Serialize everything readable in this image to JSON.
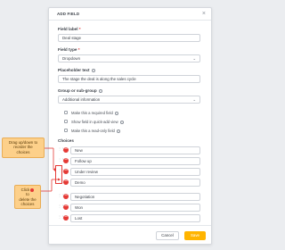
{
  "dialog": {
    "title": "ADD FIELD",
    "close_glyph": "×"
  },
  "fields": {
    "label_caption": "Field label",
    "label_required": "*",
    "label_value": "Deal stage",
    "type_caption": "Field type",
    "type_required": "*",
    "type_value": "Dropdown",
    "placeholder_caption": "Placeholder text",
    "placeholder_value": "The stage the deal is along the sales cycle",
    "group_caption": "Group or sub-group",
    "group_value": "Additional information",
    "chevron_glyph": "⌄"
  },
  "options": [
    {
      "label": "Make this a required field",
      "info": true
    },
    {
      "label": "Show field in quick-add view",
      "info": true
    },
    {
      "label": "Make this a read-only field",
      "info": true
    }
  ],
  "choices_caption": "Choices",
  "choices": [
    "New",
    "Follow up",
    "Under review",
    "Demo",
    "Negotiation",
    "Won",
    "Lost"
  ],
  "footer": {
    "cancel_label": "Cancel",
    "save_label": "Save"
  },
  "annotations": {
    "reorder_lines": [
      "Drag up/down to",
      "reorder the",
      "choices"
    ],
    "delete_lines": [
      "Click",
      "to",
      "delete the",
      "choices"
    ]
  },
  "colors": {
    "accent": "#ffb400",
    "delete": "#e53935",
    "callout_fill": "#fdd08a"
  }
}
